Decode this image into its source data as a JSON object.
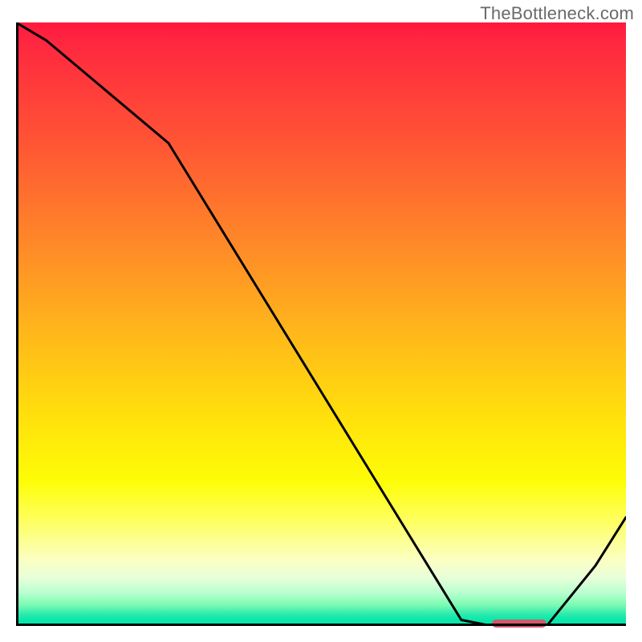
{
  "watermark": "TheBottleneck.com",
  "chart_data": {
    "type": "line",
    "title": "",
    "xlabel": "",
    "ylabel": "",
    "xlim": [
      0,
      100
    ],
    "ylim": [
      0,
      100
    ],
    "series": [
      {
        "name": "curve",
        "x": [
          0,
          5,
          25,
          73,
          78,
          87,
          95,
          100
        ],
        "values": [
          100,
          97,
          80,
          1,
          0,
          0,
          10,
          18
        ]
      }
    ],
    "background_gradient": {
      "top_color": "#ff193e",
      "bottom_color": "#08e6aa"
    },
    "marker": {
      "x_start": 78,
      "x_end": 87,
      "y": 0,
      "color": "#d2596b"
    }
  }
}
